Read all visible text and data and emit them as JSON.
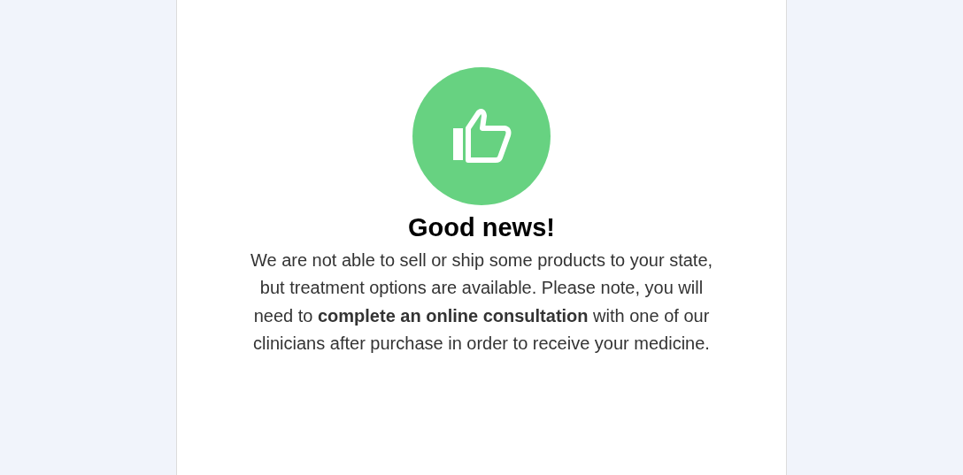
{
  "notice": {
    "title": "Good news!",
    "message": "We are not able to sell or ship some products to your state, but treatment options are available. Please note, you will need to **complete an online consultation** with one of our clinicians after purchase in order to receive your medicine."
  }
}
